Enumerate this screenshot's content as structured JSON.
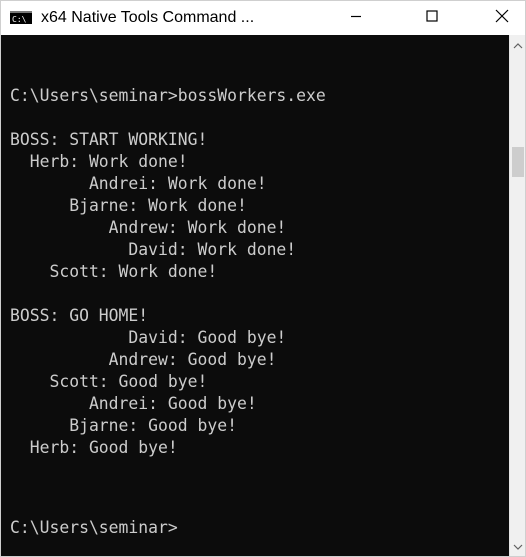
{
  "window": {
    "title": "x64 Native Tools Command ..."
  },
  "console": {
    "lines": [
      "",
      "C:\\Users\\seminar>bossWorkers.exe",
      "",
      "BOSS: START WORKING!",
      "  Herb: Work done!",
      "        Andrei: Work done!",
      "      Bjarne: Work done!",
      "          Andrew: Work done!",
      "            David: Work done!",
      "    Scott: Work done!",
      "",
      "BOSS: GO HOME!",
      "            David: Good bye!",
      "          Andrew: Good bye!",
      "    Scott: Good bye!",
      "        Andrei: Good bye!",
      "      Bjarne: Good bye!",
      "  Herb: Good bye!",
      "",
      "C:\\Users\\seminar>"
    ]
  },
  "colors": {
    "console_background": "#0c0c0c",
    "console_text": "#cccccc",
    "titlebar_background": "#ffffff"
  },
  "icons": {
    "app": "cmd-icon",
    "minimize": "minimize-icon",
    "maximize": "maximize-icon",
    "close": "close-icon",
    "scroll_up": "chevron-up-icon",
    "scroll_down": "chevron-down-icon"
  }
}
